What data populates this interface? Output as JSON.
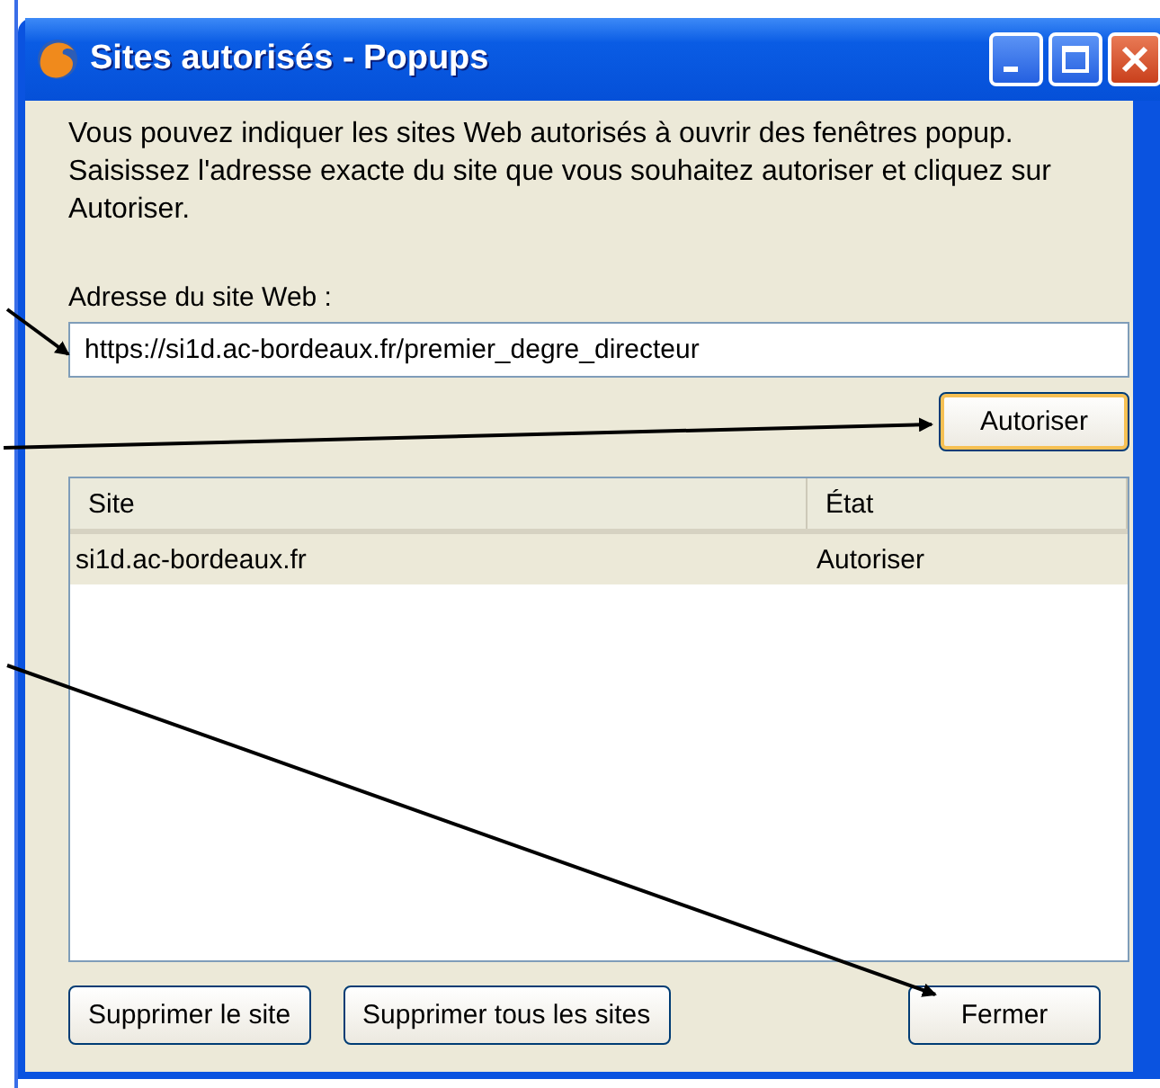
{
  "window": {
    "title": "Sites autorisés - Popups"
  },
  "intro": "Vous pouvez indiquer les sites Web autorisés à ouvrir des fenêtres popup. Saisissez l'adresse exacte du site que vous souhaitez autoriser et cliquez sur Autoriser.",
  "address": {
    "label": "Adresse du site Web :",
    "value": "https://si1d.ac-bordeaux.fr/premier_degre_directeur"
  },
  "allow_button": "Autoriser",
  "table": {
    "columns": [
      "Site",
      "État"
    ],
    "rows": [
      {
        "site": "si1d.ac-bordeaux.fr",
        "state": "Autoriser",
        "selected": true
      }
    ]
  },
  "buttons": [
    {
      "label": "Supprimer le site"
    },
    {
      "label": "Supprimer tous les sites"
    }
  ],
  "close_button": "Fermer"
}
